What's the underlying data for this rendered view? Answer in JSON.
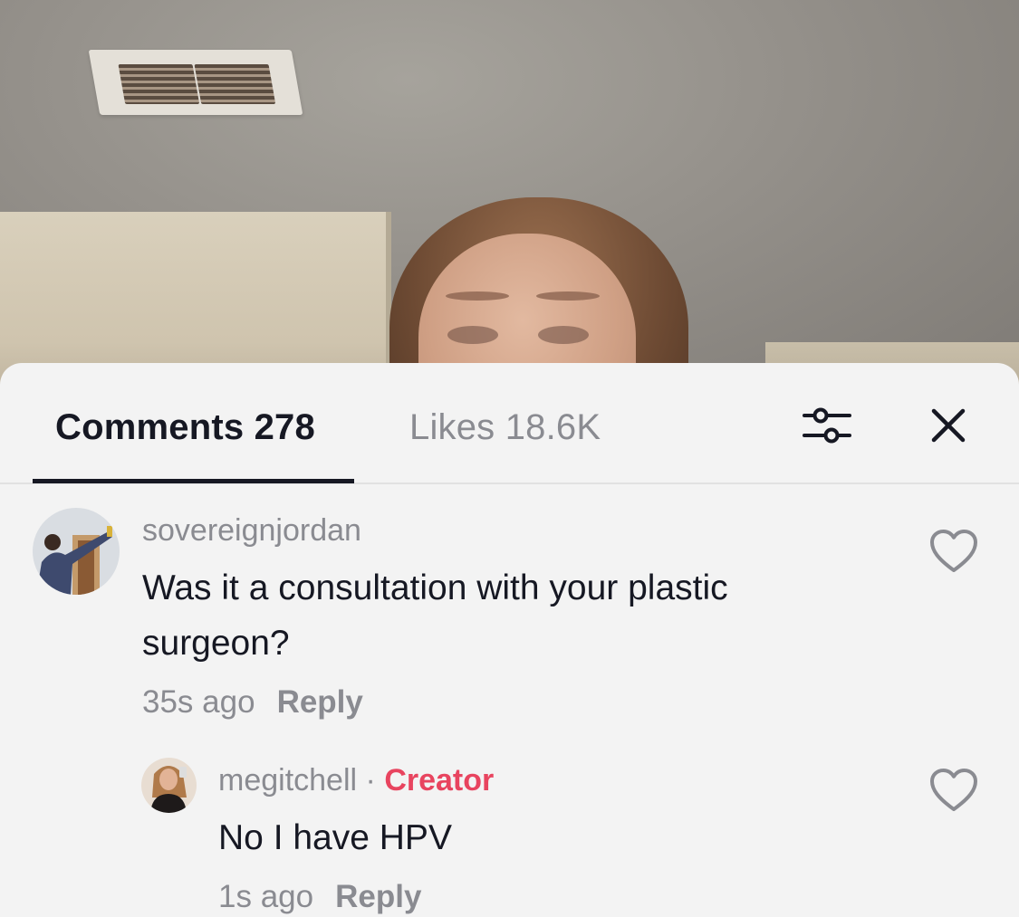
{
  "tabs": {
    "comments_label": "Comments 278",
    "likes_label": "Likes 18.6K"
  },
  "icons": {
    "filter": "sliders-icon",
    "close": "close-icon",
    "like": "heart-outline-icon"
  },
  "colors": {
    "creator_accent": "#e8445f",
    "text_primary": "#161823",
    "text_secondary": "#8a8b91"
  },
  "comments": [
    {
      "username": "sovereignjordan",
      "text": "Was it a consultation with your plastic surgeon?",
      "time": "35s ago",
      "reply_label": "Reply",
      "replies": [
        {
          "username": "megitchell",
          "separator": "·",
          "badge": "Creator",
          "text": "No I have HPV",
          "time": "1s ago",
          "reply_label": "Reply"
        }
      ]
    }
  ]
}
